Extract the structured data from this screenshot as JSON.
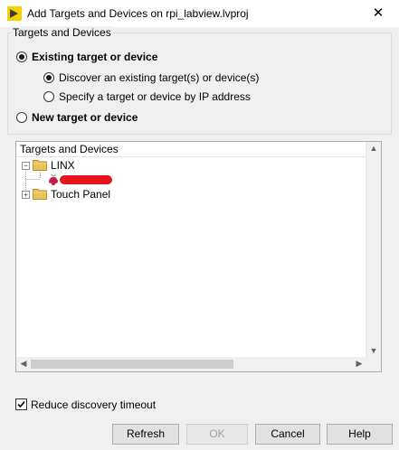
{
  "window": {
    "title": "Add Targets and Devices on rpi_labview.lvproj",
    "close_glyph": "✕"
  },
  "group": {
    "label": "Targets and Devices",
    "existing_label": "Existing target or device",
    "discover_label": "Discover an existing target(s) or device(s)",
    "specify_label": "Specify a target or device by IP address",
    "new_label": "New target or device",
    "existing_selected": true,
    "discover_selected": true
  },
  "tree": {
    "header": "Targets and Devices",
    "items": [
      {
        "label": "LINX",
        "expanded": true,
        "icon": "folder-icon"
      },
      {
        "label": "",
        "icon": "raspberry-pi-icon",
        "redacted": true
      },
      {
        "label": "Touch Panel",
        "expanded": false,
        "icon": "folder-icon"
      }
    ]
  },
  "options": {
    "reduce_timeout_label": "Reduce discovery timeout",
    "reduce_timeout_checked": true
  },
  "buttons": {
    "refresh": "Refresh",
    "ok": "OK",
    "cancel": "Cancel",
    "help": "Help"
  },
  "colors": {
    "redaction": "#e8141c",
    "window_bg": "#f0f0f0",
    "folder": "#e8c35a"
  }
}
